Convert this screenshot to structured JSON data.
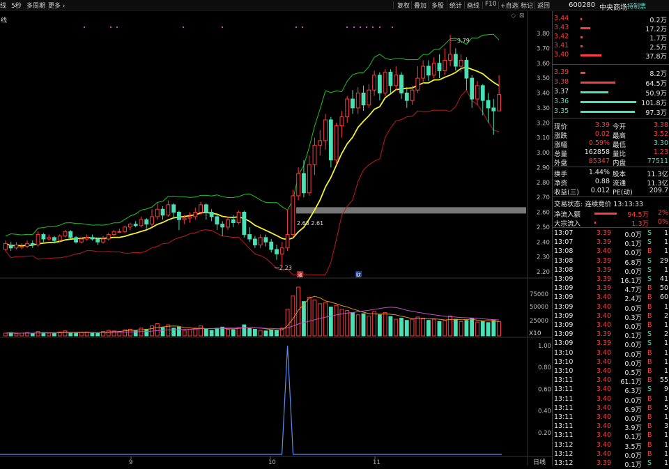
{
  "toolbar": {
    "left": [
      "线",
      "5秒",
      "多周期",
      "更多 ›"
    ],
    "right": [
      "复权",
      "叠加",
      "多股",
      "统计",
      "画线",
      "F10",
      "+自选",
      "标记",
      "返回"
    ]
  },
  "stock": {
    "code": "600280",
    "name": "中央商场",
    "badge": "持制票"
  },
  "chart_label": "线",
  "price_axis": [
    "3.80",
    "3.70",
    "3.60",
    "3.50",
    "3.40",
    "3.30",
    "3.20",
    "3.10",
    "3.00",
    "2.90",
    "2.80",
    "2.70",
    "2.60",
    "2.50",
    "2.40",
    "2.30",
    "2.20"
  ],
  "annotations": {
    "high": "3.79",
    "low": "2.23",
    "mid": "2.63 2.61",
    "zhang": "涨",
    "cai": "财"
  },
  "vol_axis": [
    "75000",
    "50000",
    "25000"
  ],
  "vol_unit": "X10",
  "ind_axis": [
    "1.00",
    "0.80",
    "0.60",
    "0.40",
    "0.20"
  ],
  "x_labels": [
    "9",
    "10",
    "11"
  ],
  "bottom_right": "日线",
  "order_book": {
    "asks": [
      {
        "price": "3.44",
        "vol": "0.2万",
        "w": 2
      },
      {
        "price": "3.43",
        "vol": "17.2万",
        "w": 14
      },
      {
        "price": "3.42",
        "vol": "1.7万",
        "w": 3
      },
      {
        "price": "3.41",
        "vol": "2.5万",
        "w": 3
      },
      {
        "price": "3.40",
        "vol": "37.8万",
        "w": 30
      }
    ],
    "bids": [
      {
        "price": "3.39",
        "vol": "8.2万",
        "w": 7,
        "c": "red"
      },
      {
        "price": "3.38",
        "vol": "64.5万",
        "w": 50,
        "c": "red"
      },
      {
        "price": "3.37",
        "vol": "50.9万",
        "w": 40,
        "c": "wht"
      },
      {
        "price": "3.36",
        "vol": "101.8万",
        "w": 80,
        "c": "grn"
      },
      {
        "price": "3.35",
        "vol": "97.3万",
        "w": 78,
        "c": "grn"
      }
    ]
  },
  "quote": [
    {
      "l1": "现价",
      "v1": "3.39",
      "c1": "red",
      "l2": "今开",
      "v2": "3.38",
      "c2": "red"
    },
    {
      "l1": "涨跌",
      "v1": "0.02",
      "c1": "red",
      "l2": "最高",
      "v2": "3.52",
      "c2": "red"
    },
    {
      "l1": "涨幅",
      "v1": "0.59%",
      "c1": "red",
      "l2": "最低",
      "v2": "3.30",
      "c2": "grn"
    },
    {
      "l1": "总量",
      "v1": "162858",
      "c1": "wht",
      "l2": "量比",
      "v2": "1.23",
      "c2": "red"
    },
    {
      "l1": "外盘",
      "v1": "85347",
      "c1": "red",
      "l2": "内盘",
      "v2": "77511",
      "c2": "grn"
    }
  ],
  "fund": [
    {
      "l1": "换手",
      "v1": "1.44%",
      "l2": "股本",
      "v2": "11.3亿"
    },
    {
      "l1": "净资",
      "v1": "0.88",
      "l2": "流通",
      "v2": "11.3亿"
    },
    {
      "l1": "收益(三)",
      "v1": "0.012",
      "l2": "PE(动)",
      "v2": "209.7"
    }
  ],
  "status": "交易状态: 连续竞价 13:13:33",
  "flow": [
    {
      "label": "净流入额",
      "val": "94.5万",
      "pct": "2%"
    },
    {
      "label": "大宗流入",
      "val": "1.3万",
      "pct": "0%"
    }
  ],
  "ticks": [
    {
      "t": "13:07",
      "p": "3.39",
      "v": "0.0万",
      "s": "S",
      "n": "1"
    },
    {
      "t": "13:07",
      "p": "3.39",
      "v": "0.1万",
      "s": "S",
      "n": "1"
    },
    {
      "t": "13:08",
      "p": "3.40",
      "v": "0.0万",
      "s": "B",
      "n": "1"
    },
    {
      "t": "13:08",
      "p": "3.39",
      "v": "6.8万",
      "s": "S",
      "n": "29"
    },
    {
      "t": "13:08",
      "p": "3.39",
      "v": "0.0万",
      "s": "S",
      "n": "1"
    },
    {
      "t": "13:09",
      "p": "3.39",
      "v": "16.1万",
      "s": "S",
      "n": "41"
    },
    {
      "t": "13:09",
      "p": "3.39",
      "v": "4.7万",
      "s": "B",
      "n": "50"
    },
    {
      "t": "13:09",
      "p": "3.40",
      "v": "2.4万",
      "s": "B",
      "n": "60"
    },
    {
      "t": "13:09",
      "p": "3.40",
      "v": "0.0万",
      "s": "B",
      "n": "1"
    },
    {
      "t": "13:09",
      "p": "3.40",
      "v": "0.3万",
      "s": "B",
      "n": "2"
    },
    {
      "t": "13:09",
      "p": "3.40",
      "v": "0.0万",
      "s": "B",
      "n": "1"
    },
    {
      "t": "13:09",
      "p": "3.39",
      "v": "0.1万",
      "s": "S",
      "n": "2"
    },
    {
      "t": "13:09",
      "p": "3.39",
      "v": "0.0万",
      "s": "S",
      "n": "1"
    },
    {
      "t": "13:10",
      "p": "3.40",
      "v": "0.0万",
      "s": "B",
      "n": "1"
    },
    {
      "t": "13:10",
      "p": "3.40",
      "v": "0.0万",
      "s": "B",
      "n": "1"
    },
    {
      "t": "13:10",
      "p": "3.40",
      "v": "0.5万",
      "s": "B",
      "n": "1"
    },
    {
      "t": "13:11",
      "p": "3.40",
      "v": "61.1万",
      "s": "B",
      "n": "55"
    },
    {
      "t": "13:11",
      "p": "3.40",
      "v": "6.3万",
      "s": "S",
      "n": "9"
    },
    {
      "t": "13:11",
      "p": "3.40",
      "v": "0.0万",
      "s": "B",
      "n": "1"
    },
    {
      "t": "13:11",
      "p": "3.40",
      "v": "6.9万",
      "s": "B",
      "n": "5"
    },
    {
      "t": "13:11",
      "p": "3.40",
      "v": "0.0万",
      "s": "B",
      "n": "1"
    },
    {
      "t": "13:11",
      "p": "3.40",
      "v": "3.9万",
      "s": "B",
      "n": "3"
    },
    {
      "t": "13:11",
      "p": "3.40",
      "v": "0.1万",
      "s": "B",
      "n": "1"
    },
    {
      "t": "13:12",
      "p": "3.40",
      "v": "3.5万",
      "s": "B",
      "n": "1"
    },
    {
      "t": "13:12",
      "p": "3.40",
      "v": "0.0万",
      "s": "B",
      "n": "1"
    },
    {
      "t": "13:12",
      "p": "3.39",
      "v": "0.1万",
      "s": "S",
      "n": "1"
    }
  ],
  "chart_data": {
    "type": "candlestick",
    "price_range": [
      2.18,
      3.86
    ],
    "candles": [
      [
        2.35,
        2.39,
        2.41,
        2.34
      ],
      [
        2.38,
        2.36,
        2.4,
        2.34
      ],
      [
        2.36,
        2.38,
        2.4,
        2.35
      ],
      [
        2.37,
        2.37,
        2.39,
        2.35
      ],
      [
        2.37,
        2.39,
        2.41,
        2.36
      ],
      [
        2.39,
        2.38,
        2.41,
        2.36
      ],
      [
        2.38,
        2.45,
        2.47,
        2.37
      ],
      [
        2.45,
        2.42,
        2.46,
        2.4
      ],
      [
        2.42,
        2.43,
        2.45,
        2.41
      ],
      [
        2.43,
        2.41,
        2.44,
        2.39
      ],
      [
        2.41,
        2.44,
        2.45,
        2.4
      ],
      [
        2.44,
        2.47,
        2.48,
        2.43
      ],
      [
        2.47,
        2.43,
        2.48,
        2.42
      ],
      [
        2.43,
        2.4,
        2.44,
        2.39
      ],
      [
        2.4,
        2.42,
        2.43,
        2.39
      ],
      [
        2.42,
        2.43,
        2.45,
        2.41
      ],
      [
        2.43,
        2.42,
        2.45,
        2.41
      ],
      [
        2.42,
        2.4,
        2.43,
        2.38
      ],
      [
        2.4,
        2.42,
        2.44,
        2.39
      ],
      [
        2.42,
        2.45,
        2.46,
        2.41
      ],
      [
        2.45,
        2.47,
        2.48,
        2.44
      ],
      [
        2.47,
        2.47,
        2.49,
        2.46
      ],
      [
        2.47,
        2.5,
        2.51,
        2.46
      ],
      [
        2.5,
        2.52,
        2.53,
        2.48
      ],
      [
        2.52,
        2.51,
        2.54,
        2.5
      ],
      [
        2.51,
        2.55,
        2.57,
        2.5
      ],
      [
        2.55,
        2.52,
        2.56,
        2.49
      ],
      [
        2.52,
        2.57,
        2.62,
        2.5
      ],
      [
        2.57,
        2.62,
        2.66,
        2.55
      ],
      [
        2.62,
        2.58,
        2.64,
        2.55
      ],
      [
        2.58,
        2.65,
        2.68,
        2.57
      ],
      [
        2.65,
        2.6,
        2.66,
        2.56
      ],
      [
        2.6,
        2.55,
        2.61,
        2.48
      ],
      [
        2.55,
        2.56,
        2.58,
        2.52
      ],
      [
        2.56,
        2.57,
        2.6,
        2.53
      ],
      [
        2.57,
        2.6,
        2.63,
        2.55
      ],
      [
        2.6,
        2.65,
        2.67,
        2.58
      ],
      [
        2.65,
        2.6,
        2.66,
        2.55
      ],
      [
        2.6,
        2.57,
        2.62,
        2.54
      ],
      [
        2.57,
        2.52,
        2.58,
        2.48
      ],
      [
        2.52,
        2.5,
        2.54,
        2.44
      ],
      [
        2.5,
        2.55,
        2.57,
        2.48
      ],
      [
        2.55,
        2.53,
        2.58,
        2.5
      ],
      [
        2.53,
        2.6,
        2.61,
        2.52
      ],
      [
        2.6,
        2.45,
        2.61,
        2.43
      ],
      [
        2.45,
        2.42,
        2.5,
        2.4
      ],
      [
        2.42,
        2.38,
        2.44,
        2.36
      ],
      [
        2.38,
        2.43,
        2.45,
        2.36
      ],
      [
        2.43,
        2.4,
        2.45,
        2.37
      ],
      [
        2.4,
        2.35,
        2.42,
        2.33
      ],
      [
        2.35,
        2.32,
        2.38,
        2.28
      ],
      [
        2.32,
        2.36,
        2.4,
        2.23
      ],
      [
        2.36,
        2.45,
        2.62,
        2.34
      ],
      [
        2.45,
        2.71,
        2.75,
        2.44
      ],
      [
        2.71,
        2.86,
        2.9,
        2.68
      ],
      [
        2.86,
        2.73,
        2.95,
        2.7
      ],
      [
        2.73,
        2.92,
        2.98,
        2.71
      ],
      [
        2.92,
        3.05,
        3.1,
        2.85
      ],
      [
        3.05,
        3.08,
        3.15,
        2.98
      ],
      [
        3.08,
        3.22,
        3.26,
        3.02
      ],
      [
        3.22,
        2.95,
        3.24,
        2.9
      ],
      [
        2.95,
        3.18,
        3.2,
        2.92
      ],
      [
        3.18,
        3.24,
        3.28,
        3.1
      ],
      [
        3.24,
        3.36,
        3.38,
        3.2
      ],
      [
        3.36,
        3.3,
        3.42,
        3.26
      ],
      [
        3.3,
        3.4,
        3.44,
        3.26
      ],
      [
        3.4,
        3.32,
        3.45,
        3.28
      ],
      [
        3.32,
        3.42,
        3.46,
        3.3
      ],
      [
        3.42,
        3.52,
        3.55,
        3.38
      ],
      [
        3.52,
        3.4,
        3.54,
        3.35
      ],
      [
        3.4,
        3.54,
        3.56,
        3.38
      ],
      [
        3.54,
        3.45,
        3.56,
        3.4
      ],
      [
        3.45,
        3.52,
        3.58,
        3.42
      ],
      [
        3.52,
        3.4,
        3.54,
        3.36
      ],
      [
        3.4,
        3.35,
        3.44,
        3.3
      ],
      [
        3.35,
        3.42,
        3.45,
        3.32
      ],
      [
        3.42,
        3.5,
        3.58,
        3.4
      ],
      [
        3.5,
        3.58,
        3.62,
        3.46
      ],
      [
        3.58,
        3.52,
        3.62,
        3.48
      ],
      [
        3.52,
        3.6,
        3.64,
        3.5
      ],
      [
        3.6,
        3.55,
        3.66,
        3.5
      ],
      [
        3.55,
        3.62,
        3.7,
        3.52
      ],
      [
        3.62,
        3.66,
        3.79,
        3.58
      ],
      [
        3.66,
        3.58,
        3.7,
        3.55
      ],
      [
        3.58,
        3.62,
        3.66,
        3.54
      ],
      [
        3.62,
        3.5,
        3.64,
        3.42
      ],
      [
        3.5,
        3.36,
        3.52,
        3.3
      ],
      [
        3.36,
        3.45,
        3.48,
        3.32
      ],
      [
        3.45,
        3.35,
        3.46,
        3.25
      ],
      [
        3.35,
        3.3,
        3.4,
        3.2
      ],
      [
        3.3,
        3.28,
        3.36,
        3.12
      ],
      [
        3.28,
        3.39,
        3.52,
        3.3
      ]
    ],
    "volume": [
      5,
      6,
      4,
      5,
      6,
      4,
      8,
      6,
      5,
      5,
      7,
      9,
      6,
      5,
      6,
      7,
      6,
      5,
      8,
      10,
      9,
      8,
      11,
      12,
      10,
      14,
      12,
      18,
      22,
      15,
      20,
      14,
      16,
      10,
      12,
      14,
      18,
      12,
      10,
      14,
      16,
      12,
      11,
      15,
      20,
      14,
      12,
      10,
      9,
      11,
      10,
      14,
      48,
      72,
      88,
      62,
      70,
      65,
      58,
      60,
      52,
      55,
      48,
      46,
      42,
      38,
      40,
      36,
      44,
      38,
      42,
      35,
      30,
      32,
      28,
      30,
      34,
      32,
      28,
      30,
      26,
      28,
      36,
      30,
      26,
      28,
      32,
      25,
      26,
      24,
      28,
      26
    ],
    "flat_line_value": 2.61,
    "indicator_spike_index": 52,
    "indicator_spike_value": 1.0
  }
}
